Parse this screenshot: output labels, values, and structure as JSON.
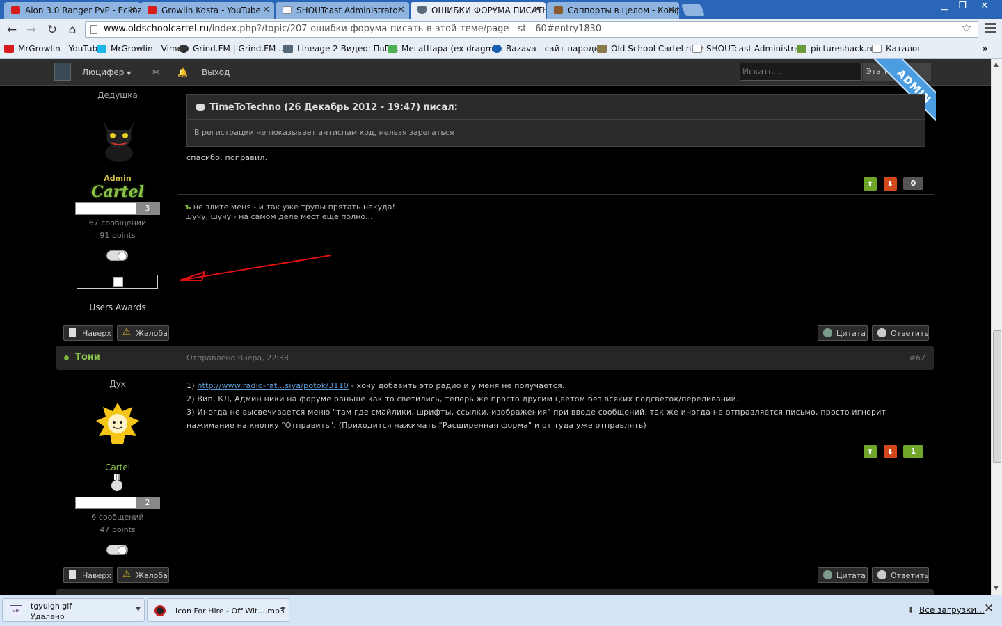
{
  "browser": {
    "tabs": [
      {
        "label": "Aion 3.0 Ranger PvP - Eckoz",
        "icon_color": "#d81b1b"
      },
      {
        "label": "Growlin Kosta - YouTube",
        "icon_color": "#d81b1b"
      },
      {
        "label": "SHOUTcast Administrator",
        "icon_color": "#ffffff"
      },
      {
        "label": "ОШИБКИ ФОРУМА ПИСАТЬ",
        "icon_color": "#5a6a7a"
      },
      {
        "label": "Саппорты в целом - Конфе",
        "icon_color": "#8a5a2a"
      }
    ],
    "url_host": "www.oldschoolcartel.ru",
    "url_path": "/index.php?/topic/207-ошибки-форума-писать-в-этой-теме/page__st__60#entry1830",
    "bookmarks": [
      {
        "label": "MrGrowlin - YouTube",
        "icon_color": "#d81b1b"
      },
      {
        "label": "MrGrowlin - Vimeo",
        "icon_color": "#1ab7ea"
      },
      {
        "label": "Grind.FM | Grind.FM ...",
        "icon_color": "#333333"
      },
      {
        "label": "Lineage 2 Видео: ПвП...",
        "icon_color": "#556677"
      },
      {
        "label": "МегаШара (ex dragm...",
        "icon_color": "#4caf50"
      },
      {
        "label": "Bazava - сайт пароди...",
        "icon_color": "#1a5fb4"
      },
      {
        "label": "Old School Cartel new",
        "icon_color": "#8a7a4a"
      },
      {
        "label": "SHOUTcast Administra...",
        "icon_color": "#ffffff"
      },
      {
        "label": "pictureshack.ru",
        "icon_color": "#6a9a3a"
      },
      {
        "label": "Каталог",
        "icon_color": "#ffffff"
      }
    ]
  },
  "userbar": {
    "username": "Люцифер",
    "logout": "Выход",
    "search_placeholder": "Искать...",
    "search_scope": "Эта тема",
    "ribbon": "ADMIN"
  },
  "post1": {
    "user_title": "Дедушка",
    "group_line1": "Admin",
    "group_line2": "Cartel",
    "post_count_badge": "3",
    "messages": "67 сообщений",
    "points": "91 points",
    "awards": "Users Awards",
    "quote_header": "TimeToTechno (26 Декабрь 2012 - 19:47) писал:",
    "quote_body": "В регистрации не показывает антиспам код, нельзя зарегаться",
    "body": "спасибо, поправил.",
    "reputation": "0",
    "reputation_color": "#555555",
    "sig_prefix": "ъ",
    "sig_line1": " не злите меня - и так уже трупы прятать некуда!",
    "sig_line2": "шучу, шучу - на самом деле мест ещё полно...",
    "btn_top": "Наверх",
    "btn_report": "Жалоба",
    "btn_quote": "Цитата",
    "btn_reply": "Ответить"
  },
  "post2": {
    "author": "Тони",
    "date": "Отправлено Вчера, 22:38",
    "number": "#67",
    "user_title": "Дух",
    "group": "Cartel",
    "post_count_badge": "2",
    "messages": "6 сообщений",
    "points": "47 points",
    "line1_prefix": "1) ",
    "line1_link": "http://www.radio-rat...siya/potok/3110",
    "line1_suffix": " - хочу добавить это радио и у меня не получается.",
    "line2": "2) Вип, КЛ, Админ ники на форуме раньше как то светились, теперь же просто другим цветом без всяких подсветок/переливаний.",
    "line3": "3) Иногда не высвечивается меню \"там где смайлики, шрифты, ссылки, изображения\" при вводе сообщений, так же иногда не отправляется письмо, просто игнорит",
    "line4": "нажимание на кнопку \"Отправить\". (Приходится нажимать \"Расширенная форма\" и от туда уже отправлять)",
    "reputation": "1",
    "reputation_color": "#6fa529",
    "btn_top": "Наверх",
    "btn_report": "Жалоба",
    "btn_quote": "Цитата",
    "btn_reply": "Ответить"
  },
  "downloads": [
    {
      "name": "tgyuigh.gif",
      "status": "Удалено",
      "icon": "gif-file-icon"
    },
    {
      "name": "Icon For Hire - Off Wit....mp3",
      "status": "",
      "icon": "audio-file-icon"
    }
  ],
  "all_downloads": "Все загрузки..."
}
